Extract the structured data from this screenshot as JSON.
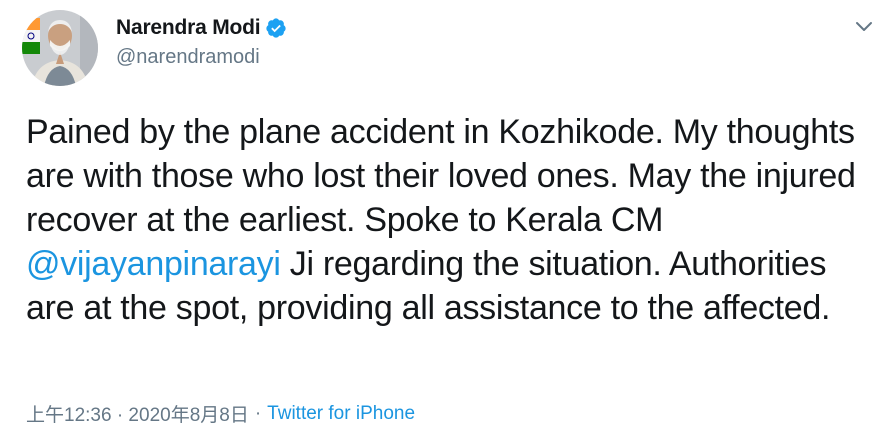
{
  "user": {
    "display_name": "Narendra Modi",
    "handle": "@narendramodi",
    "verified": true,
    "avatar_icon": "profile-photo"
  },
  "tweet": {
    "text_before": "Pained by the plane accident in Kozhikode. My thoughts are with those who lost their loved ones. May the injured recover at the earliest. Spoke to Kerala CM ",
    "mention": "@vijayanpinarayi",
    "text_after": " Ji regarding the situation. Authorities are at the spot, providing all assistance to the affected."
  },
  "meta": {
    "time": "上午12:36 · 2020年8月8日",
    "separator": "·",
    "source": "Twitter for iPhone"
  },
  "colors": {
    "link": "#1b95e0",
    "secondary": "#657786",
    "text": "#14171a",
    "verified": "#1da1f2"
  },
  "icons": {
    "verified": "verified-badge-icon",
    "more": "chevron-down-icon"
  }
}
